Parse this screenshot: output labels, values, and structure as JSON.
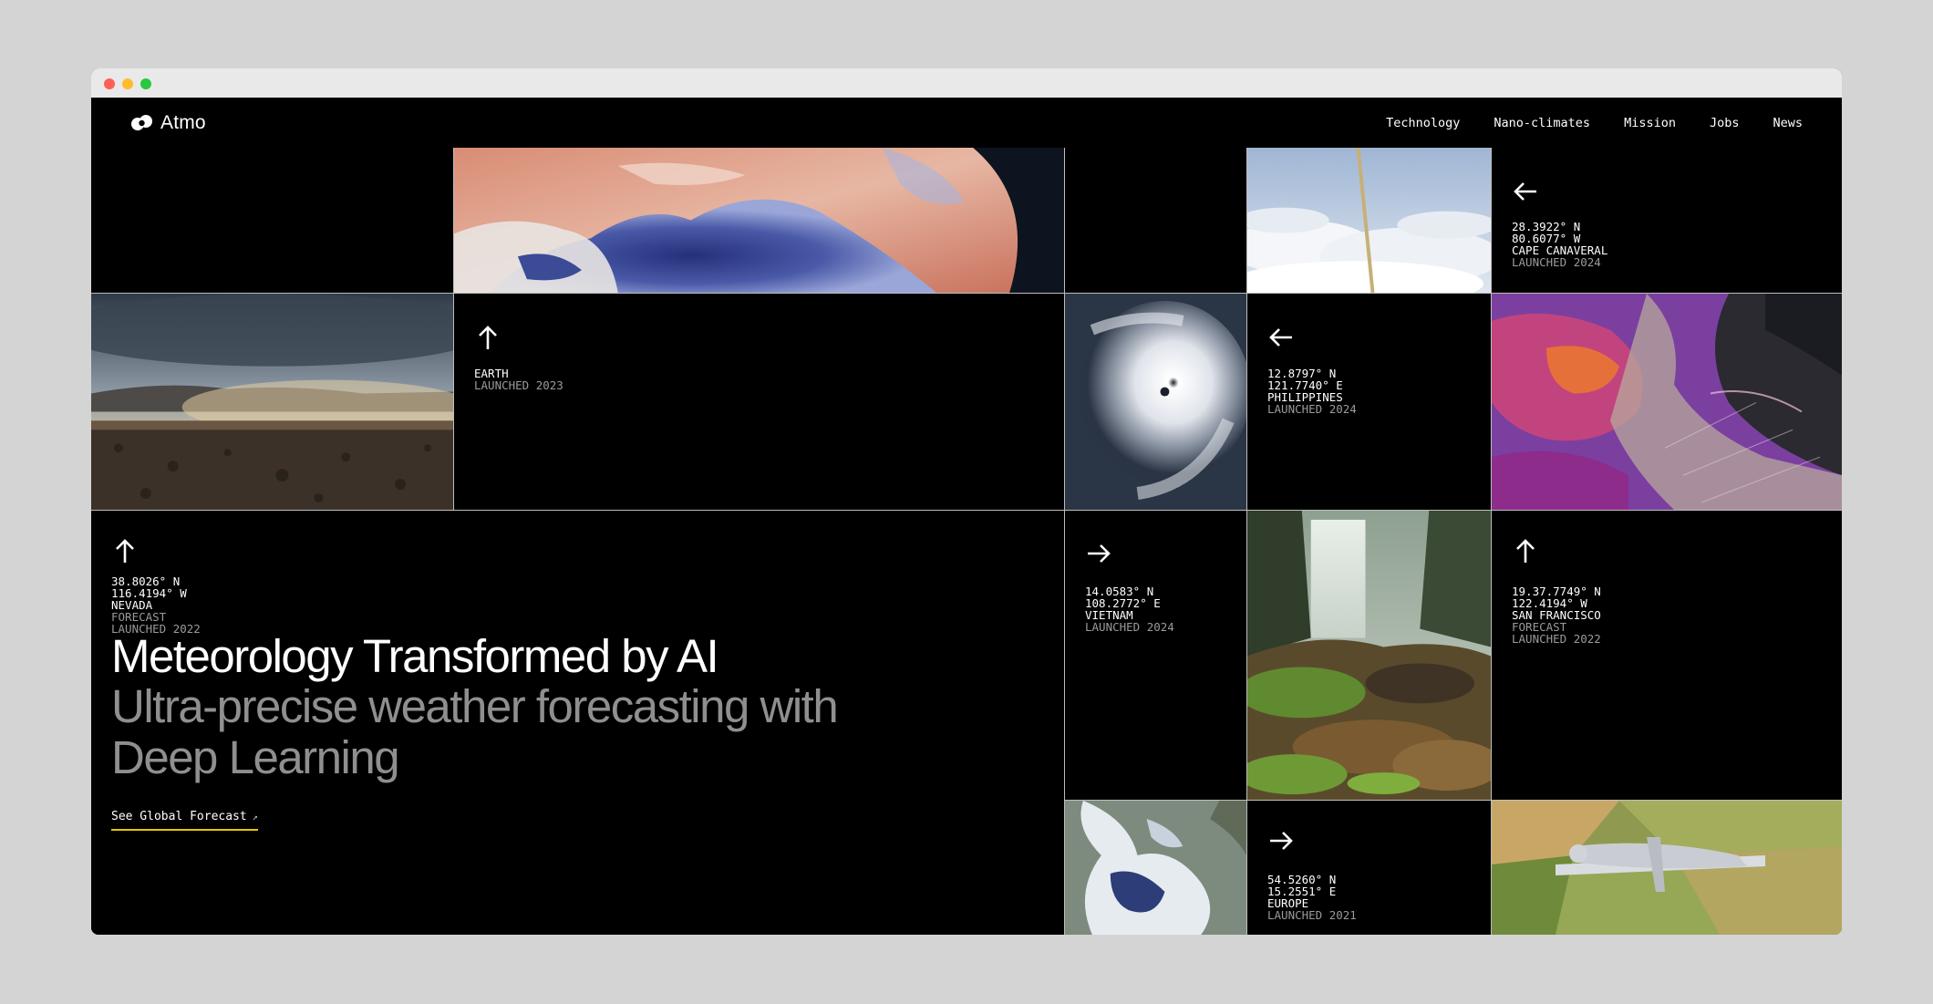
{
  "brand": {
    "name": "Atmo"
  },
  "nav": {
    "items": [
      "Technology",
      "Nano-climates",
      "Mission",
      "Jobs",
      "News"
    ]
  },
  "tiles": {
    "earth": {
      "lines": [
        "EARTH"
      ],
      "dim": [
        "LAUNCHED 2023"
      ]
    },
    "cape": {
      "lines": [
        "28.3922° N",
        "80.6077° W",
        "CAPE CANAVERAL"
      ],
      "dim": [
        "LAUNCHED 2024"
      ]
    },
    "philippines": {
      "lines": [
        "12.8797° N",
        "121.7740° E",
        "PHILIPPINES"
      ],
      "dim": [
        "LAUNCHED 2024"
      ]
    },
    "nevada": {
      "lines": [
        "38.8026° N",
        "116.4194° W",
        "NEVADA"
      ],
      "dim": [
        "FORECAST",
        "LAUNCHED 2022"
      ]
    },
    "vietnam": {
      "lines": [
        "14.0583° N",
        "108.2772° E",
        "VIETNAM"
      ],
      "dim": [
        "LAUNCHED 2024"
      ]
    },
    "sanfrancisco": {
      "lines": [
        "19.37.7749° N",
        "122.4194° W",
        "SAN FRANCISCO"
      ],
      "dim": [
        "FORECAST",
        "LAUNCHED 2022"
      ]
    },
    "europe": {
      "lines": [
        "54.5260° N",
        "15.2551° E",
        "EUROPE"
      ],
      "dim": [
        "LAUNCHED 2021"
      ]
    }
  },
  "hero": {
    "title": "Meteorology Transformed by AI",
    "subtitle": "Ultra-precise weather forecasting with Deep Learning",
    "cta": "See Global Forecast",
    "cta_arrow": "↗"
  },
  "colors": {
    "accent": "#e8c400",
    "background": "#000000",
    "muted": "#8f8f8f"
  }
}
